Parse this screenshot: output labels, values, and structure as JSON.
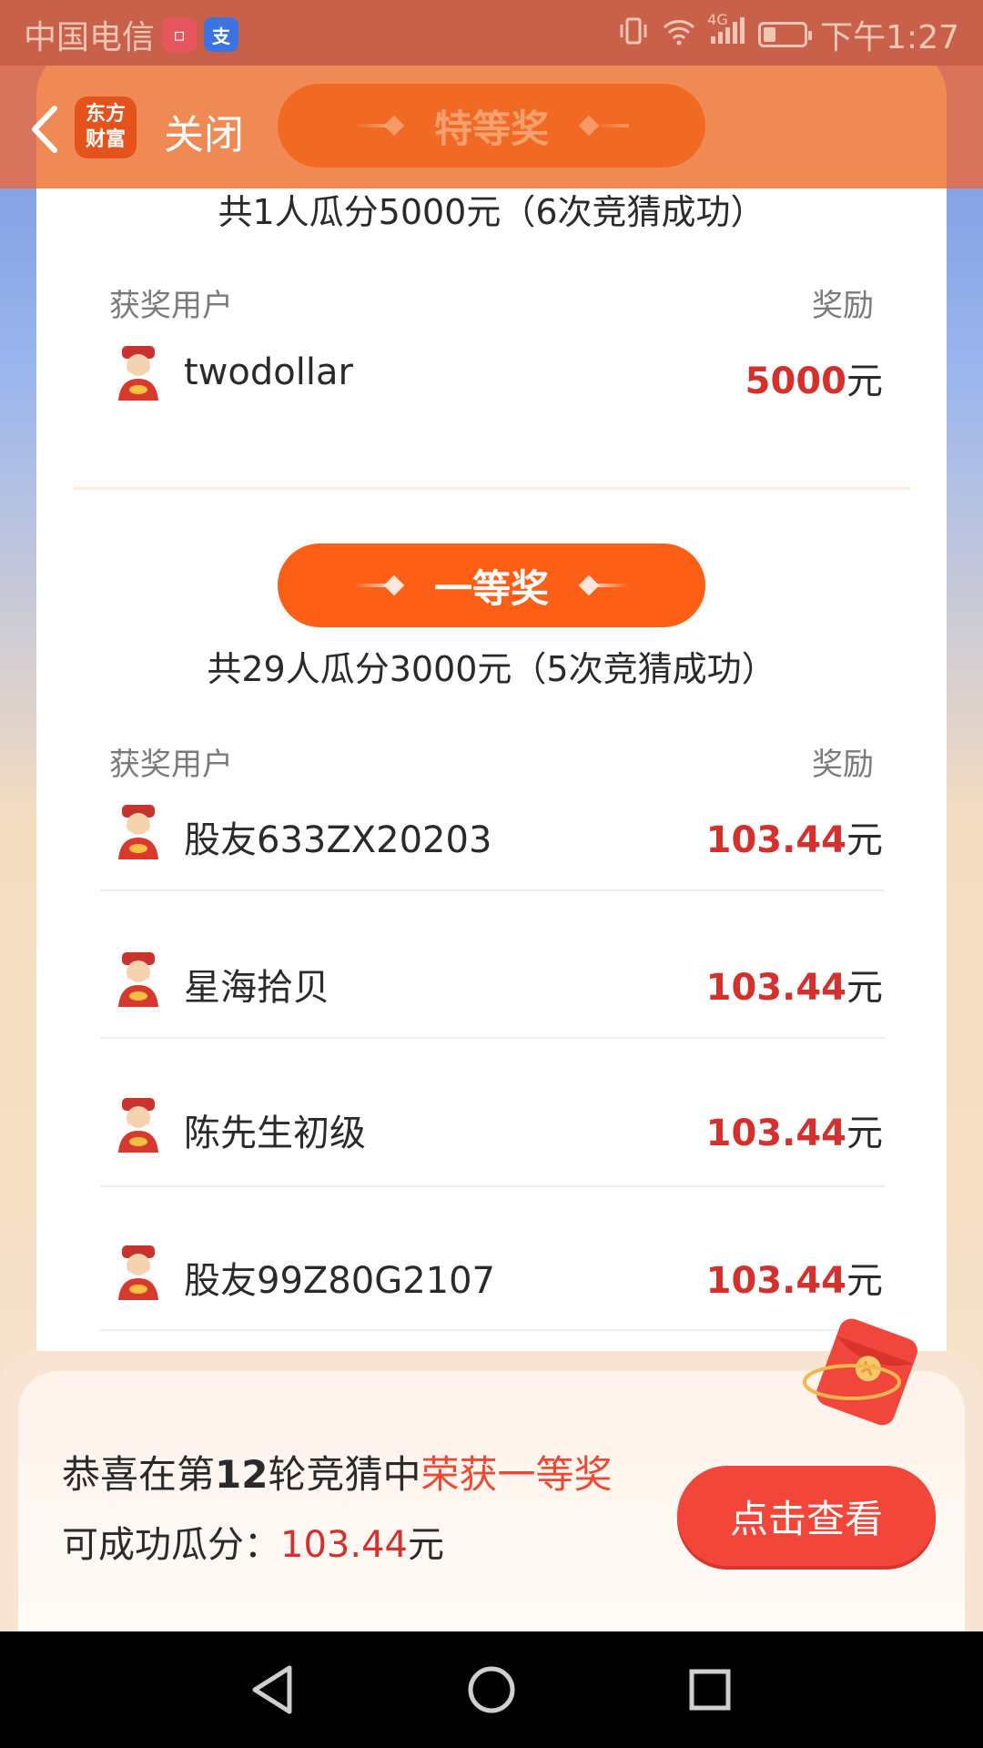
{
  "status_bar": {
    "carrier": "中国电信",
    "network": "4G",
    "time": "下午1:27",
    "battery_fraction": 0.3
  },
  "header": {
    "logo_text_line1": "东方",
    "logo_text_line2": "财富",
    "close_label": "关闭",
    "sticky_prize_title": "特等奖"
  },
  "special_prize": {
    "summary": "共1人瓜分5000元（6次竞猜成功）",
    "col_user": "获奖用户",
    "col_reward": "奖励",
    "winners": [
      {
        "name": "twodollar",
        "amount": "5000",
        "unit": "元"
      }
    ]
  },
  "first_prize": {
    "title": "一等奖",
    "summary": "共29人瓜分3000元（5次竞猜成功）",
    "col_user": "获奖用户",
    "col_reward": "奖励",
    "winners": [
      {
        "name": "股友633ZX20203",
        "amount": "103.44",
        "unit": "元"
      },
      {
        "name": "星海拾贝",
        "amount": "103.44",
        "unit": "元"
      },
      {
        "name": "陈先生初级",
        "amount": "103.44",
        "unit": "元"
      },
      {
        "name": "股友99Z80G2107",
        "amount": "103.44",
        "unit": "元"
      }
    ]
  },
  "congrats": {
    "prefix": "恭喜在第",
    "round": "12",
    "middle": "轮竞猜中",
    "highlight": "荣获一等奖",
    "line2_label": "可成功瓜分：",
    "line2_amount": "103.44",
    "line2_unit": "元",
    "button_label": "点击查看"
  },
  "colors": {
    "accent_orange": "#fe5f16",
    "amount_red": "#d4312e",
    "button_red": "#f3463a"
  }
}
